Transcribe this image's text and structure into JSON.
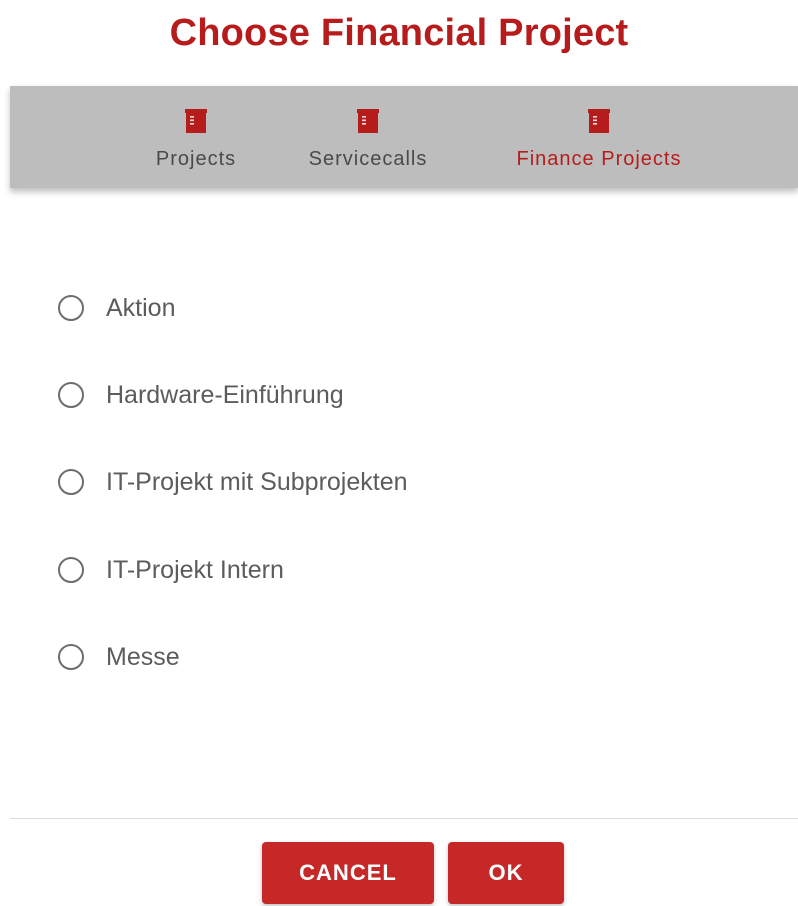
{
  "dialog": {
    "title": "Choose Financial Project"
  },
  "tabs": [
    {
      "label": "Projects",
      "icon": "clipboard-icon",
      "active": false
    },
    {
      "label": "Servicecalls",
      "icon": "clipboard-icon",
      "active": false
    },
    {
      "label": "Finance Projects",
      "icon": "clipboard-icon",
      "active": true
    }
  ],
  "options": [
    {
      "label": "Aktion",
      "selected": false
    },
    {
      "label": "Hardware-Einführung",
      "selected": false
    },
    {
      "label": "IT-Projekt mit Subprojekten",
      "selected": false
    },
    {
      "label": "IT-Projekt Intern",
      "selected": false
    },
    {
      "label": "Messe",
      "selected": false
    }
  ],
  "actions": {
    "cancel_label": "CANCEL",
    "ok_label": "OK"
  },
  "colors": {
    "accent": "#b71c1c",
    "tabbar": "#bdbdbd",
    "button": "#c62828"
  }
}
